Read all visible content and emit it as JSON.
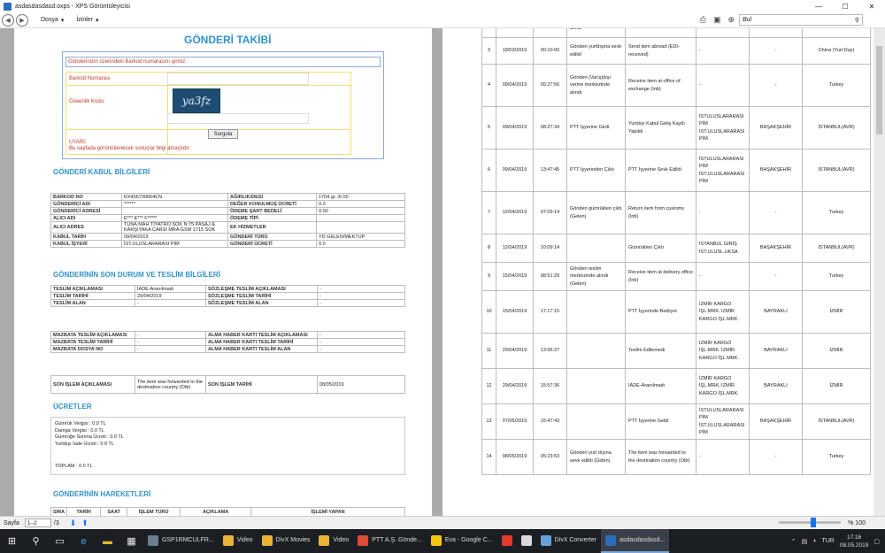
{
  "window": {
    "title": "asdasdasdasd.oxps - XPS Görüntüleyicisi",
    "min": "—",
    "max": "☐",
    "close": "✕"
  },
  "menu": {
    "file": "Dosya",
    "permissions": "İzinler"
  },
  "search": {
    "placeholder": "Bul",
    "icon": "⚲"
  },
  "page1": {
    "title": "GÖNDERİ TAKİBİ",
    "hint": "Gönderinizin üzerindeki Barkod numarasını giriniz.",
    "barcode_label": "Barkod Numarası",
    "security_label": "Güvenlik Kodu:",
    "captcha": "ya3fz",
    "query_button": "Sorgula",
    "warning_title": "UYARI:",
    "warning_text": "Bu sayfada görüntülenecek sonuçlar bilgi amaçlıdır.",
    "sec_acceptance": "GÖNDERİ KABUL BİLGİLERİ",
    "acceptance_rows": [
      [
        "BARKOD NO",
        "RX456730664CN",
        "AĞIRLIK/DESİ",
        "1704 gr. /0.00"
      ],
      [
        "GÖNDERİCİ ADI",
        "******",
        "DEĞER KONULMUŞ ÜCRETİ",
        "0.0"
      ],
      [
        "GÖNDERİCİ ADRESİ",
        "",
        "ÖDEME ŞART BEDELİ",
        "0.00"
      ],
      [
        "ALICI ADI",
        "E*** E*** F*****",
        "ÖDEME TİPİ",
        ""
      ],
      [
        "ALICI ADRES",
        "TUNA MAH TİYATRO SOK N:75 PASAJ & KARŞIYAKA CARSI MRA GSM 1715 SOK",
        "EK HİZMETLER",
        ""
      ],
      [
        "KABUL TARİH",
        "09/04/2019",
        "GÖNDERİ TÜRÜ",
        "YD GELEN/MEKTUP"
      ],
      [
        "KABUL İŞYERİ",
        "İST.ULUSLARARASI PİM",
        "GÖNDERİ ÜCRETİ",
        "0.0"
      ]
    ],
    "sec_status": "GÖNDERİNİN SON DURUM VE TESLİM BİLGİLERİ",
    "status_rows": [
      [
        "TESLİM AÇIKLAMASI",
        "İADE-Aranılmadı",
        "SÖZLEŞME TESLİM AÇIKLAMASI",
        "-"
      ],
      [
        "TESLİM TARİHİ",
        "29/04/2019",
        "SÖZLEŞME TESLİM TARİHİ",
        "-"
      ],
      [
        "TESLİM ALAN",
        "-",
        "SÖZLEŞME TESLİM ALAN",
        "-"
      ]
    ],
    "mazbata_rows": [
      [
        "MAZBATA TESLİM AÇIKLAMASI",
        "-",
        "ALMA HABER KARTI TESLİM AÇIKLAMASI",
        "-"
      ],
      [
        "MAZBATA TESLİM TARİHİ",
        "-",
        "ALMA HABER KARTI TESLİM TARİHİ",
        "-"
      ],
      [
        "MAZBATA DOSYA NO",
        "-",
        "ALMA HABER KARTI TESLİM ALAN",
        "-"
      ]
    ],
    "last_op": [
      "SON İŞLEM AÇIKLAMASI",
      "The item was forwarded to the destination country (Otb)",
      "SON İŞLEM TARİHİ",
      "08/05/2019"
    ],
    "sec_fees": "ÜCRETLER",
    "fees": [
      "Gümrük Vergisi  : 0.0 TL",
      "Damga Vergisi  : 0.0 TL",
      "Gümrüğe Sunma Ücreti : 0.0 TL",
      "Yurtdışı İade Ücreti : 0.0 TL"
    ],
    "fees_total": "TOPLAM : 0.0 TL",
    "sec_moves": "GÖNDERİNİN HAREKETLERİ",
    "moves_head": [
      "SIRA",
      "TARİH",
      "SAAT",
      "İŞLEM TÜRÜ",
      "AÇIKLAMA",
      "İŞLEMİ YAPAN"
    ]
  },
  "page2_rows": [
    [
      "",
      "",
      "",
      "alındı",
      "",
      "",
      "",
      ""
    ],
    [
      "3",
      "18/03/2019",
      "00:10:00",
      "Gönderi yurtdışına sevk edildi",
      "Send item abroad (EDI-received)",
      "-",
      "-",
      "China (Yurt Dışı)"
    ],
    [
      "4",
      "09/04/2019",
      "05:27:56",
      "Gönderi (Varış)dışı verme merkezinde alındı",
      "Receive item at office of exchange (Inb)",
      "-",
      "-",
      "Turkey"
    ],
    [
      "5",
      "09/04/2019",
      "08:27:34",
      "PTT İşyerine Girdi",
      "Yurtdışı Kabul Geliş Kaydı Yapıldı",
      "İSTULUSLARARASI PİM İST.ULUSLARARASI PİM",
      "BAŞAKŞEHİR",
      "İSTANBUL(AVR)"
    ],
    [
      "6",
      "09/04/2019",
      "13:47:45",
      "PTT İşyerinden Çıktı",
      "PTT İşyerine Sevk Edildi",
      "İSTULUSLARARASI PİM İST.ULUSLARARASI PİM",
      "BAŞAKŞEHİR",
      "İSTANBUL(AVR)"
    ],
    [
      "7",
      "12/04/2019",
      "07:09:14",
      "Gönderi gümrükten çıktı (Gelen)",
      "Return item from customs (Inb)",
      "-",
      "-",
      "Turkey"
    ],
    [
      "8",
      "12/04/2019",
      "10:09:14",
      "",
      "Gümrükten Çıktı",
      "İSTANBUL GİRİŞ İST.ULUSL.UKSA",
      "BAŞAKŞEHİR",
      "İSTANBUL(AVR)"
    ],
    [
      "9",
      "15/04/2019",
      "08:51:29",
      "Gönderi teslim merkezinde alındı (Gelen)",
      "Receive item at delivery office (Inb)",
      "-",
      "-",
      "Turkey"
    ],
    [
      "10",
      "15/04/2019",
      "17:17:15",
      "",
      "PTT İşyerinde Bekliyor",
      "İZMİR KARGO İŞL.MRK. İZMİR KARGO İŞL.MRK.",
      "BAYRAKLI",
      "İZMİR"
    ],
    [
      "11",
      "29/04/2019",
      "13:56:27",
      "",
      "Teslim Edilemedi",
      "İZMİR KARGO İŞL.MRK. İZMİR KARGO İŞL.MRK.",
      "BAYRAKLI",
      "İZMİR"
    ],
    [
      "12",
      "29/04/2019",
      "15:57:36",
      "",
      "İADE-Aranılmadı",
      "İZMİR KARGO İŞL.MRK. İZMİR KARGO İŞL.MRK.",
      "BAYRAKLI",
      "İZMİR"
    ],
    [
      "13",
      "07/05/2019",
      "15:47:43",
      "",
      "PTT İşyerine Geldi",
      "İSTULUSLARARASI PİM İST.ULUSLARARASI PİM",
      "BAŞAKŞEHİR",
      "İSTANBUL(AVR)"
    ],
    [
      "14",
      "08/05/2019",
      "05:23:53",
      "Gönderi yurt dışına sevk edildi (Giden)",
      "The item was forwarded to the destination country (Otb)",
      "-",
      "-",
      "Turkey"
    ]
  ],
  "status": {
    "page_label": "Sayfa",
    "page_value": "1–2",
    "page_total": "/3",
    "zoom": "% 100"
  },
  "taskbar": {
    "apps": [
      {
        "label": "GSP1RMCULFR...",
        "color": "#6b7d8f"
      },
      {
        "label": "Video",
        "color": "#e8b339"
      },
      {
        "label": "DivX Movies",
        "color": "#e8b339"
      },
      {
        "label": "Video",
        "color": "#e8b339"
      },
      {
        "label": "PTT A.Ş. Gönde...",
        "color": "#dd4b39"
      },
      {
        "label": "Eva - Google C...",
        "color": "#f2c811"
      },
      {
        "label": "",
        "color": "#e23b2e"
      },
      {
        "label": "",
        "color": "#d9d9d9"
      },
      {
        "label": "DivX Converter",
        "color": "#6aa0d8"
      },
      {
        "label": "asdasdasdasd...",
        "color": "#2a6ebb"
      }
    ],
    "lang": "TUR",
    "time": "17:16",
    "date": "08.05.2019"
  }
}
